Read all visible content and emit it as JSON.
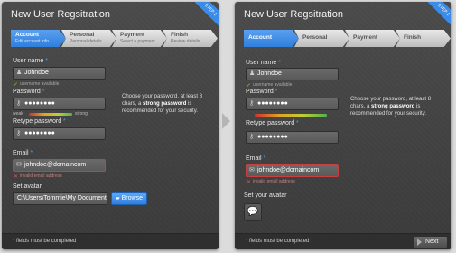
{
  "left": {
    "title": "New User Regsitration",
    "ribbon": "STEP 1",
    "steps": [
      {
        "label": "Account",
        "sub": "Edit account info"
      },
      {
        "label": "Personal",
        "sub": "Personal details"
      },
      {
        "label": "Payment",
        "sub": "Select a payment"
      },
      {
        "label": "Finish",
        "sub": "Review details"
      }
    ],
    "username_label": "User name",
    "username_value": "Johndoe",
    "username_hint": "username available",
    "password_label": "Password",
    "password_value": "●●●●●●●●",
    "meter_weak": "weak",
    "meter_strong": "strong",
    "tip_pre": "Choose your password, at least 8 chars, a ",
    "tip_bold": "strong password",
    "tip_post": " is recommended for your security.",
    "retype_label": "Retype password",
    "retype_value": "●●●●●●●●",
    "email_label": "Email",
    "email_value": "johndoe@domaincom",
    "email_hint": "invalid email address",
    "avatar_label": "Set avatar",
    "avatar_path": "C:\\Users\\Tommie\\My Document",
    "browse_label": "Browse",
    "footer_note": "fields must be completed",
    "required_mark": "*"
  },
  "right": {
    "title": "New User Regsitration",
    "ribbon": "STEP 1",
    "steps": [
      {
        "label": "Account"
      },
      {
        "label": "Personal"
      },
      {
        "label": "Payment"
      },
      {
        "label": "Finish"
      }
    ],
    "username_label": "User name",
    "username_value": "Johndoe",
    "username_hint": "username available",
    "password_label": "Password",
    "password_value": "●●●●●●●●",
    "tip_pre": "Choose your password, at least 8 chars, a ",
    "tip_bold": "strong password",
    "tip_post": " is recommended for your security.",
    "retype_label": "Retype password",
    "retype_value": "●●●●●●●●",
    "email_label": "Email",
    "email_value": "johndoe@domaincom",
    "email_hint": "invalid email address",
    "avatar_label": "Set your avatar",
    "footer_note": "fields must be completed",
    "next_label": "Next",
    "required_mark": "*"
  },
  "colors": {
    "accent": "#3b8be8",
    "error": "#c84040",
    "ok": "#7ac943"
  }
}
